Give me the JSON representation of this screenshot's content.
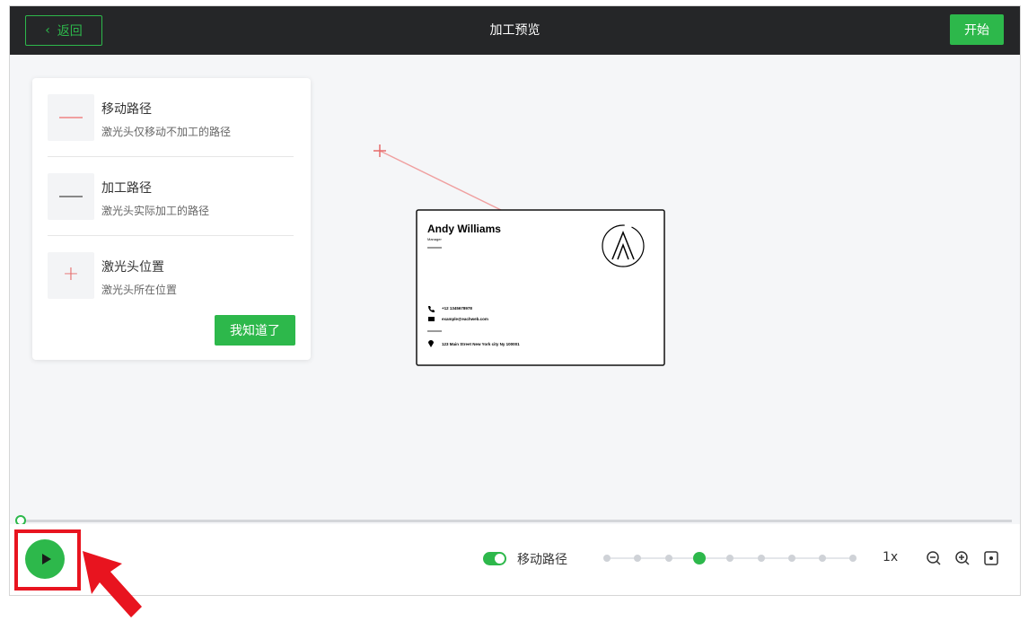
{
  "header": {
    "back_label": "返回",
    "title": "加工预览",
    "start_label": "开始"
  },
  "legend": {
    "items": [
      {
        "title": "移动路径",
        "desc": "激光头仅移动不加工的路径",
        "color": "#f0a0a0"
      },
      {
        "title": "加工路径",
        "desc": "激光头实际加工的路径",
        "color": "#888888"
      },
      {
        "title": "激光头位置",
        "desc": "激光头所在位置",
        "color": "#e66a6a"
      }
    ],
    "got_it_label": "我知道了"
  },
  "card": {
    "name": "Andy Williams",
    "role": "Manager",
    "phone": "+12 1345678978",
    "email": "example@eachweb.com",
    "address": "123 Main Street New York city Ny 100001"
  },
  "controls": {
    "toggle_label": "移动路径",
    "toggle_on": true,
    "speed_steps": 9,
    "speed_active_index": 3,
    "speed_label": "1x",
    "progress": 0
  },
  "colors": {
    "accent": "#2db84b",
    "header_bg": "#252628",
    "move_path": "#f0a0a0",
    "laser_head": "#e66a6a",
    "annotation": "#e8141f"
  },
  "icons": {
    "zoom_out": "zoom-out-icon",
    "zoom_in": "zoom-in-icon",
    "fit": "fit-screen-icon"
  }
}
